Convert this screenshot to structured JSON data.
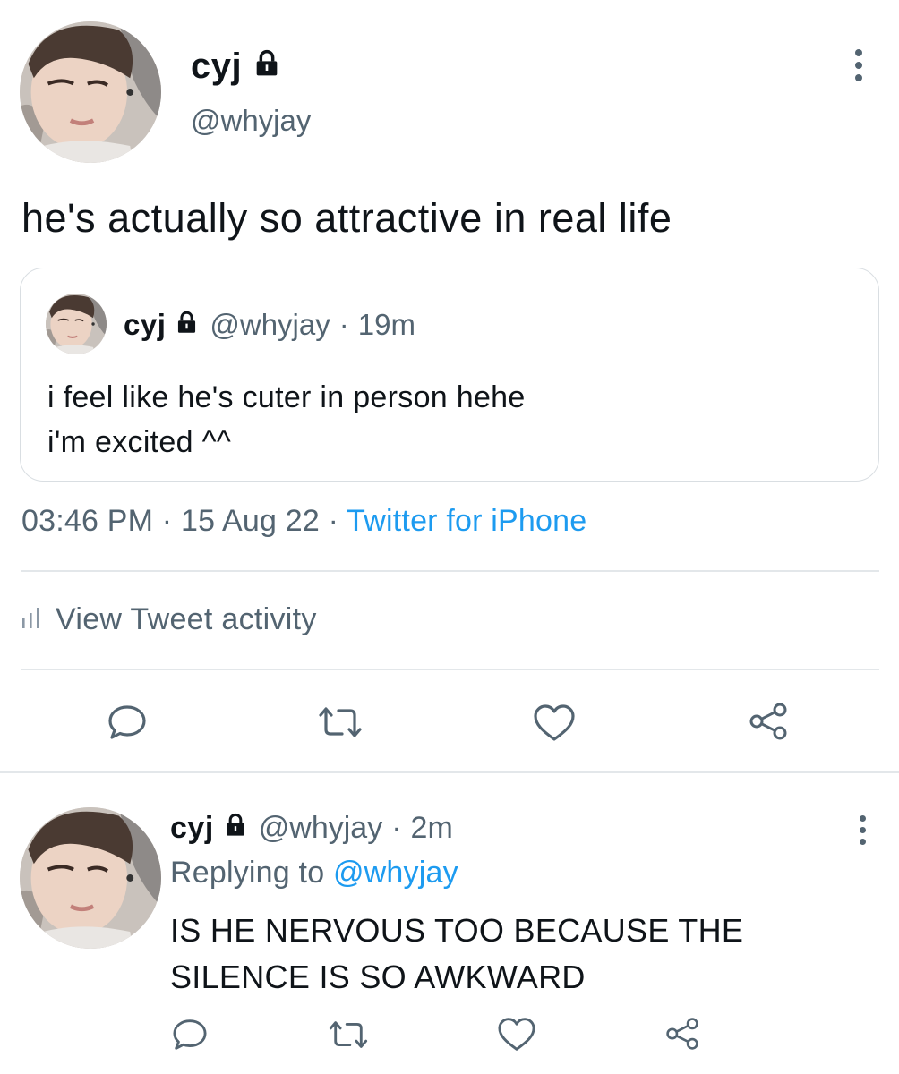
{
  "tweet": {
    "display_name": "cyj",
    "handle": "@whyjay",
    "text": "he's actually so attractive in real life",
    "time": "03:46 PM",
    "date": "15 Aug 22",
    "source": "Twitter for iPhone",
    "separator": "·",
    "activity_label": "View Tweet activity"
  },
  "quoted_tweet": {
    "display_name": "cyj",
    "handle": "@whyjay",
    "separator": "·",
    "age": "19m",
    "line1": "i feel like he's cuter in person hehe",
    "line2": "i'm excited ^^"
  },
  "reply": {
    "display_name": "cyj",
    "handle": "@whyjay",
    "separator": "·",
    "age": "2m",
    "replying_prefix": "Replying to",
    "replying_to": "@whyjay",
    "line1": "IS HE NERVOUS TOO BECAUSE THE",
    "line2": "SILENCE IS SO AWKWARD"
  },
  "icons": {
    "protected": "lock-icon",
    "more": "more-vertical-icon",
    "activity": "bar-chart-icon",
    "actions": [
      "reply-icon",
      "retweet-icon",
      "like-icon",
      "share-icon"
    ]
  },
  "colors": {
    "text": "#0f1419",
    "secondary": "#536471",
    "link": "#1d9bf0",
    "border": "#e3e7ea"
  }
}
